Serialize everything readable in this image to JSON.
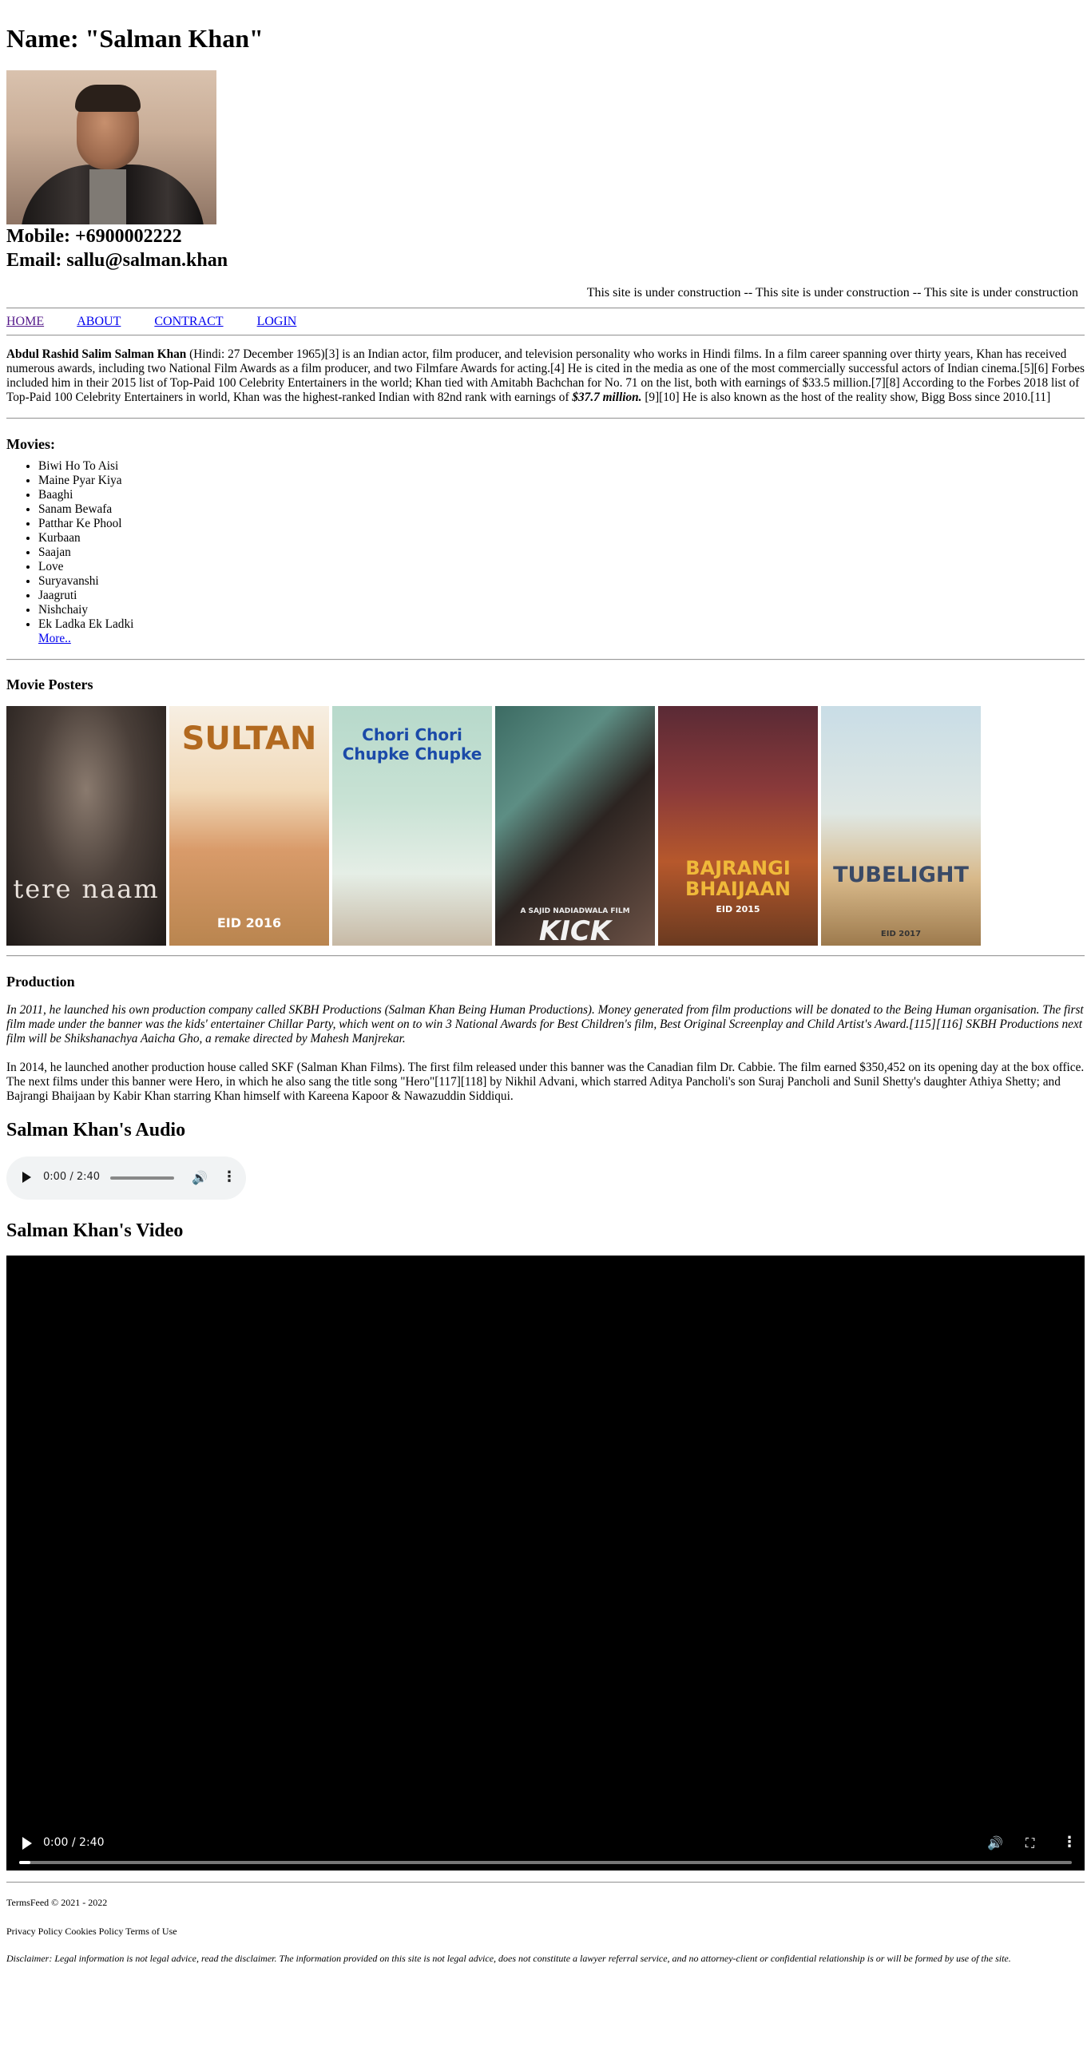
{
  "header": {
    "title": "Name: \"Salman Khan\"",
    "mobile": "Mobile: +6900002222",
    "email": "Email: sallu@salman.khan"
  },
  "marquee": "This site is under construction -- This site is under construction -- This site is under construction",
  "nav": [
    "HOME",
    "ABOUT",
    "CONTRACT",
    "LOGIN"
  ],
  "intro": {
    "bold_name": "Abdul Rashid Salim Salman Khan",
    "text1": " (Hindi: 27 December 1965)[3] is an Indian actor, film producer, and television personality who works in Hindi films. In a film career spanning over thirty years, Khan has received numerous awards, including two National Film Awards as a film producer, and two Filmfare Awards for acting.[4] He is cited in the media as one of the most commercially successful actors of Indian cinema.[5][6] Forbes included him in their 2015 list of Top-Paid 100 Celebrity Entertainers in the world; Khan tied with Amitabh Bachchan for No. 71 on the list, both with earnings of $33.5 million.[7][8] According to the Forbes 2018 list of Top-Paid 100 Celebrity Entertainers in world, Khan was the highest-ranked Indian with 82nd rank with earnings of ",
    "earnings": "$37.7 million.",
    "text2": " [9][10] He is also known as the host of the reality show, Bigg Boss since 2010.[11]"
  },
  "movies": {
    "heading": "Movies:",
    "items": [
      "Biwi Ho To Aisi",
      "Maine Pyar Kiya",
      "Baaghi",
      "Sanam Bewafa",
      "Patthar Ke Phool",
      "Kurbaan",
      "Saajan",
      "Love",
      "Suryavanshi",
      "Jaagruti",
      "Nishchaiy",
      "Ek Ladka Ek Ladki"
    ],
    "more_link": "More.."
  },
  "posters": {
    "heading": "Movie Posters",
    "items": [
      {
        "title": "tere naam",
        "caption": ""
      },
      {
        "title": "SULTAN",
        "caption": "EID 2016"
      },
      {
        "title": "Chori Chori Chupke Chupke",
        "caption": ""
      },
      {
        "title": "KICK",
        "caption": "A SAJID NADIADWALA FILM"
      },
      {
        "title": "BAJRANGI BHAIJAAN",
        "caption": "EID 2015"
      },
      {
        "title": "TUBELIGHT",
        "caption": "EID 2017"
      }
    ]
  },
  "production": {
    "heading": "Production",
    "p1": "In 2011, he launched his own production company called SKBH Productions (Salman Khan Being Human Productions). Money generated from film productions will be donated to the Being Human organisation. The first film made under the banner was the kids' entertainer Chillar Party, which went on to win 3 National Awards for Best Children's film, Best Original Screenplay and Child Artist's Award.[115][116] SKBH Productions next film will be Shikshanachya Aaicha Gho, a remake directed by Mahesh Manjrekar.",
    "p2": "In 2014, he launched another production house called SKF (Salman Khan Films). The first film released under this banner was the Canadian film Dr. Cabbie. The film earned $350,452 on its opening day at the box office. The next films under this banner were Hero, in which he also sang the title song \"Hero\"[117][118] by Nikhil Advani, which starred Aditya Pancholi's son Suraj Pancholi and Sunil Shetty's daughter Athiya Shetty; and Bajrangi Bhaijaan by Kabir Khan starring Khan himself with Kareena Kapoor & Nawazuddin Siddiqui."
  },
  "audio": {
    "heading": "Salman Khan's Audio",
    "time": "0:00 / 2:40"
  },
  "video": {
    "heading": "Salman Khan's Video",
    "time": "0:00 / 2:40"
  },
  "footer": {
    "copyright": "TermsFeed © 2021 - 2022",
    "links": "Privacy Policy Cookies Policy Terms of Use",
    "disclaimer": "Disclaimer: Legal information is not legal advice, read the disclaimer. The information provided on this site is not legal advice, does not constitute a lawyer referral service, and no attorney-client or confidential relationship is or will be formed by use of the site."
  },
  "colors": {
    "link": "#0000ee",
    "visited": "#551a8b",
    "video_bg": "#000000",
    "audio_bg": "#f1f3f4"
  }
}
